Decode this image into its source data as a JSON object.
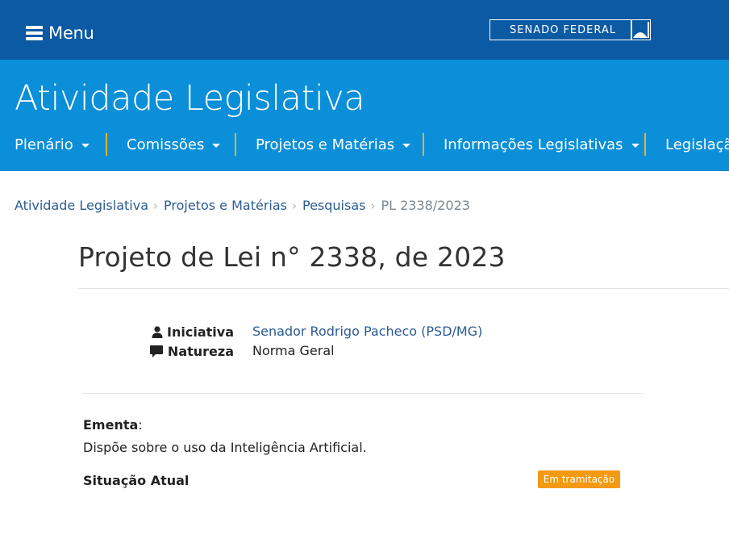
{
  "topbar": {
    "menu_label": "Menu",
    "senado_label": "SENADO FEDERAL"
  },
  "header": {
    "title": "Atividade Legislativa",
    "nav": [
      {
        "label": "Plenário"
      },
      {
        "label": "Comissões"
      },
      {
        "label": "Projetos e Matérias"
      },
      {
        "label": "Informações Legislativas"
      },
      {
        "label": "Legislação"
      }
    ]
  },
  "breadcrumb": {
    "items": [
      "Atividade Legislativa",
      "Projetos e Matérias",
      "Pesquisas"
    ],
    "current": "PL 2338/2023"
  },
  "page": {
    "title": "Projeto de Lei n° 2338, de 2023"
  },
  "info": {
    "iniciativa_label": "Iniciativa",
    "iniciativa_value": "Senador Rodrigo Pacheco (PSD/MG)",
    "natureza_label": "Natureza",
    "natureza_value": "Norma Geral"
  },
  "ementa": {
    "label": "Ementa",
    "text": "Dispõe sobre o uso da Inteligência Artificial."
  },
  "situacao": {
    "label": "Situação Atual",
    "badge": "Em tramitação",
    "badge_color": "#f39a12"
  },
  "colors": {
    "topbar": "#0b5aa3",
    "header": "#0a8fd8",
    "nav_separator": "#f0b030",
    "link": "#2b5c93"
  }
}
